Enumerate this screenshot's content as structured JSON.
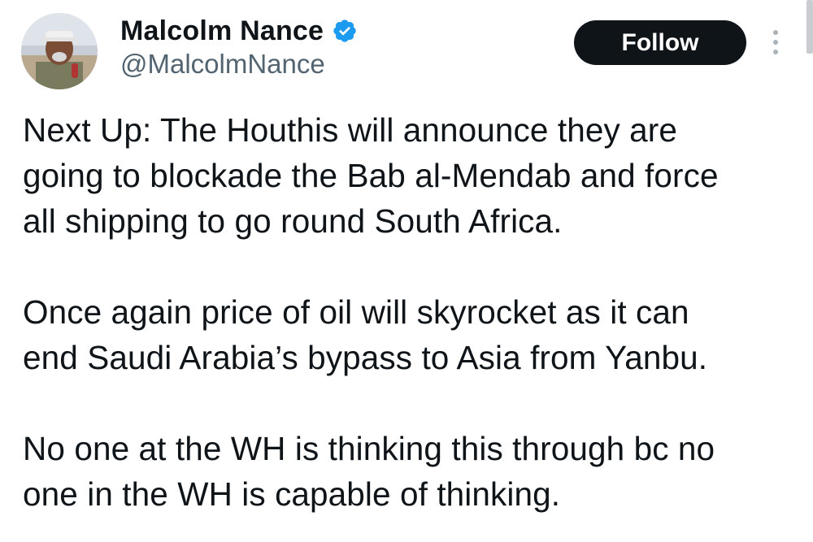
{
  "author": {
    "display_name": "Malcolm Nance",
    "handle": "@MalcolmNance",
    "verified_icon": "verified-badge-icon",
    "avatar_icon": "profile-avatar"
  },
  "actions": {
    "follow_label": "Follow",
    "more_icon": "more-options-icon"
  },
  "tweet": {
    "paragraphs": [
      "Next Up:  The Houthis will announce they are\ngoing to blockade the Bab al-Mendab and force\nall shipping to go round South Africa.",
      "Once again price of oil will skyrocket as it can\nend Saudi Arabia’s bypass to Asia from Yanbu.",
      "No one at the WH is thinking this through bc no\none in the WH is capable of thinking."
    ]
  },
  "colors": {
    "text_primary": "#0f1419",
    "text_secondary": "#536471",
    "verified_blue": "#1d9bf0",
    "follow_bg": "#0f1419",
    "follow_text": "#ffffff"
  }
}
